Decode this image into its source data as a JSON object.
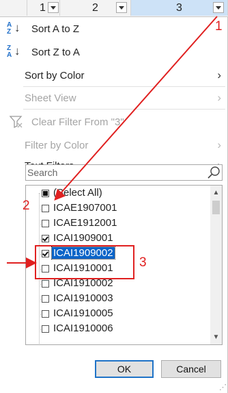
{
  "header": {
    "columns": [
      {
        "label": "1"
      },
      {
        "label": "2"
      },
      {
        "label": "3"
      }
    ]
  },
  "menu": {
    "sort_az": "Sort A to Z",
    "sort_za": "Sort Z to A",
    "sort_by_color": "Sort by Color",
    "sheet_view": "Sheet View",
    "clear_filter": "Clear Filter From \"3\"",
    "filter_by_color": "Filter by Color",
    "text_filters": "Text Filters"
  },
  "search": {
    "placeholder": "Search"
  },
  "list": {
    "items": [
      {
        "label": "(Select All)",
        "state": "partial"
      },
      {
        "label": "ICAE1907001",
        "state": "unchecked"
      },
      {
        "label": "ICAE1912001",
        "state": "unchecked"
      },
      {
        "label": "ICAI1909001",
        "state": "checked"
      },
      {
        "label": "ICAI1909002",
        "state": "checked"
      },
      {
        "label": "ICAI1910001",
        "state": "unchecked"
      },
      {
        "label": "ICAI1910002",
        "state": "unchecked"
      },
      {
        "label": "ICAI1910003",
        "state": "unchecked"
      },
      {
        "label": "ICAI1910005",
        "state": "unchecked"
      },
      {
        "label": "ICAI1910006",
        "state": "unchecked"
      }
    ]
  },
  "buttons": {
    "ok": "OK",
    "cancel": "Cancel"
  },
  "annotations": {
    "one": "1",
    "two": "2",
    "three": "3",
    "color": "#e02020"
  },
  "icons": [
    "filter-dropdown-icon",
    "sort-ascending-icon",
    "sort-descending-icon",
    "chevron-right-icon",
    "clear-filter-icon",
    "search-icon",
    "scroll-up-icon",
    "scroll-down-icon"
  ]
}
